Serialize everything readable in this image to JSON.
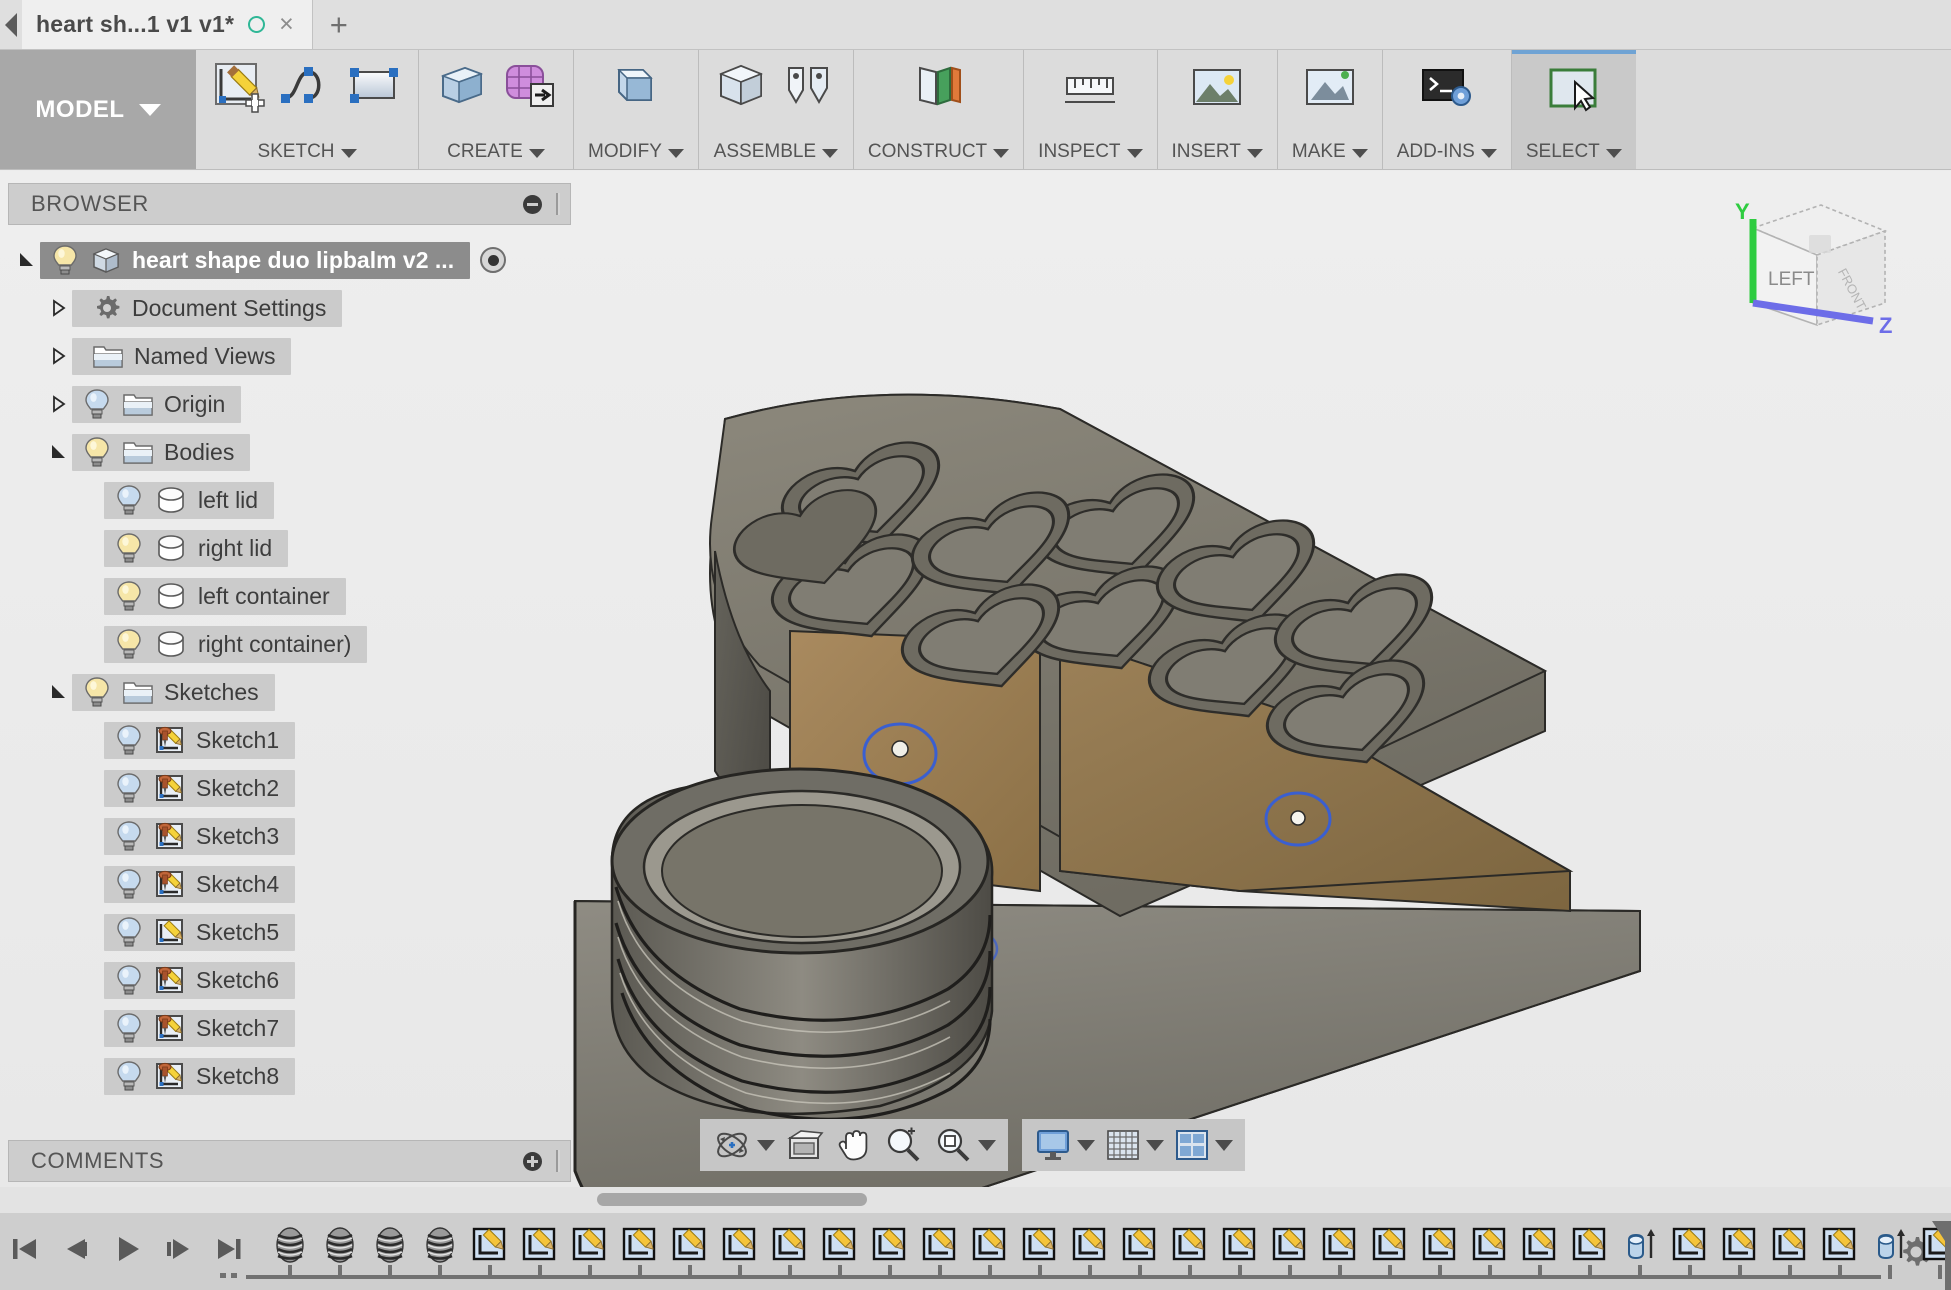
{
  "tab": {
    "title": "heart sh...1 v1 v1*",
    "save_indicator": "unsaved-circle-icon",
    "close_label": "×",
    "new_tab_label": "+"
  },
  "ribbon": {
    "workspace": {
      "label": "MODEL",
      "caret": "▼"
    },
    "groups": [
      {
        "label": "SKETCH",
        "icons": [
          "create-sketch-icon",
          "spline-icon",
          "rectangle-icon"
        ]
      },
      {
        "label": "CREATE",
        "icons": [
          "extrude-icon",
          "create-form-icon"
        ]
      },
      {
        "label": "MODIFY",
        "icons": [
          "press-pull-icon"
        ]
      },
      {
        "label": "ASSEMBLE",
        "icons": [
          "new-component-icon",
          "joint-icon"
        ]
      },
      {
        "label": "CONSTRUCT",
        "icons": [
          "offset-plane-icon"
        ]
      },
      {
        "label": "INSPECT",
        "icons": [
          "measure-icon"
        ]
      },
      {
        "label": "INSERT",
        "icons": [
          "insert-mcmaster-icon"
        ]
      },
      {
        "label": "MAKE",
        "icons": [
          "3d-print-icon"
        ]
      },
      {
        "label": "ADD-INS",
        "icons": [
          "scripts-addins-icon"
        ]
      },
      {
        "label": "SELECT",
        "icons": [
          "select-cursor-icon"
        ]
      }
    ]
  },
  "browser": {
    "title": "BROWSER",
    "collapse_icon": "minus-circle-icon",
    "root": {
      "label": "heart shape duo lipbalm v2 ...",
      "bulb": "on",
      "icon": "component-icon",
      "selected": true,
      "radio": "active-component-radio"
    },
    "items": [
      {
        "label": "Document Settings",
        "bulb": "none",
        "icon": "gear-icon",
        "expander": "collapsed",
        "indent": 1
      },
      {
        "label": "Named Views",
        "bulb": "none",
        "icon": "folder-icon",
        "expander": "collapsed",
        "indent": 1
      },
      {
        "label": "Origin",
        "bulb": "off",
        "icon": "folder-icon",
        "expander": "collapsed",
        "indent": 1
      },
      {
        "label": "Bodies",
        "bulb": "on",
        "icon": "folder-icon",
        "expander": "expanded",
        "indent": 1
      },
      {
        "label": "left lid",
        "bulb": "off",
        "icon": "body-icon",
        "expander": "none",
        "indent": 2
      },
      {
        "label": "right lid",
        "bulb": "on",
        "icon": "body-icon",
        "expander": "none",
        "indent": 2
      },
      {
        "label": "left container",
        "bulb": "on",
        "icon": "body-icon",
        "expander": "none",
        "indent": 2
      },
      {
        "label": "right container)",
        "bulb": "on",
        "icon": "body-icon",
        "expander": "none",
        "indent": 2
      },
      {
        "label": "Sketches",
        "bulb": "on",
        "icon": "folder-icon",
        "expander": "expanded",
        "indent": 1
      },
      {
        "label": "Sketch1",
        "bulb": "off",
        "icon": "sketch-pinned-icon",
        "expander": "none",
        "indent": 2
      },
      {
        "label": "Sketch2",
        "bulb": "off",
        "icon": "sketch-pinned-icon",
        "expander": "none",
        "indent": 2
      },
      {
        "label": "Sketch3",
        "bulb": "off",
        "icon": "sketch-pinned-icon",
        "expander": "none",
        "indent": 2
      },
      {
        "label": "Sketch4",
        "bulb": "off",
        "icon": "sketch-pinned-icon",
        "expander": "none",
        "indent": 2
      },
      {
        "label": "Sketch5",
        "bulb": "off",
        "icon": "sketch-icon",
        "expander": "none",
        "indent": 2
      },
      {
        "label": "Sketch6",
        "bulb": "off",
        "icon": "sketch-pinned-icon",
        "expander": "none",
        "indent": 2
      },
      {
        "label": "Sketch7",
        "bulb": "off",
        "icon": "sketch-pinned-icon",
        "expander": "none",
        "indent": 2
      },
      {
        "label": "Sketch8",
        "bulb": "off",
        "icon": "sketch-pinned-icon",
        "expander": "none",
        "indent": 2
      }
    ]
  },
  "comments": {
    "title": "COMMENTS",
    "add_icon": "plus-circle-icon"
  },
  "viewcube": {
    "face_label": "LEFT",
    "axis_y": "Y",
    "axis_z": "Z",
    "axis_y_color": "#2ecc40",
    "axis_z_color": "#6d6de8"
  },
  "navbar": {
    "items": [
      {
        "name": "orbit-icon",
        "caret": true
      },
      {
        "name": "look-at-icon",
        "caret": false
      },
      {
        "name": "pan-icon",
        "caret": false
      },
      {
        "name": "zoom-icon",
        "caret": false
      },
      {
        "name": "zoom-window-icon",
        "caret": true
      }
    ],
    "display_items": [
      {
        "name": "display-settings-icon",
        "caret": true
      },
      {
        "name": "grid-snap-icon",
        "caret": true
      },
      {
        "name": "viewports-icon",
        "caret": true
      }
    ]
  },
  "timeline": {
    "playback": [
      "go-to-beginning-icon",
      "step-back-icon",
      "play-icon",
      "step-forward-icon",
      "go-to-end-icon"
    ],
    "features": [
      "coil-icon",
      "coil-icon",
      "coil-icon",
      "coil-icon",
      "sketch-icon",
      "sketch-icon",
      "sketch-icon",
      "sketch-icon",
      "sketch-icon",
      "sketch-icon",
      "sketch-icon",
      "sketch-icon",
      "sketch-icon",
      "sketch-icon",
      "sketch-icon",
      "sketch-icon",
      "sketch-icon",
      "sketch-icon",
      "sketch-icon",
      "sketch-icon",
      "sketch-icon",
      "sketch-icon",
      "sketch-icon",
      "sketch-icon",
      "sketch-icon",
      "sketch-icon",
      "sketch-icon",
      "extrude-icon",
      "sketch-icon",
      "sketch-icon",
      "sketch-icon",
      "sketch-icon",
      "extrude-icon",
      "sketch-icon"
    ],
    "settings_icon": "gear-icon",
    "marker_position_index": 33
  },
  "model": {
    "description": "heart-shape duo lipbalm mold 3D solid body with threaded cylindrical cavity",
    "body_color": "#7d7a70",
    "highlight_face_color": "#9c7f58",
    "background_top": "#eeeeee",
    "background_bottom": "#e8e8e8"
  }
}
